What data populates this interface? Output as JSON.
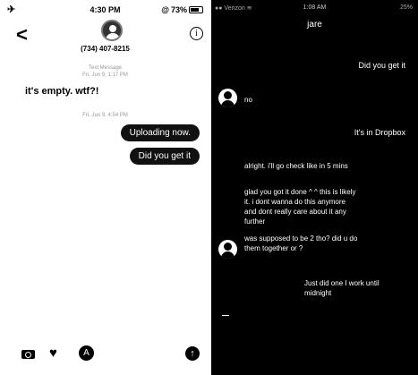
{
  "left_status": {
    "time": "4:30 PM",
    "battery": "73%"
  },
  "left_header": {
    "back_icon": "chevron-left-icon",
    "contact": "(734) 407-8215",
    "info_icon": "info-icon"
  },
  "left_meta1": [
    "Text Message",
    "Fri, Jun 9, 1:17 PM"
  ],
  "left_msg_received": "it's empty. wtf?!",
  "left_meta2": "Fri, Jun 9, 4:54 PM",
  "left_msg_sent": [
    "Uploading now.",
    "Did you get it"
  ],
  "left_bottom_icons": [
    "camera-icon",
    "heart-icon",
    "app-store-icon",
    "send-arrow-icon"
  ],
  "right_status": {
    "carrier": "Verizon",
    "time": "1:08 AM",
    "battery": "25%"
  },
  "right_title": "jare",
  "right_messages": [
    "Did you get it",
    "no",
    "It's in Dropbox",
    "alright. i'll go check like in 5 mins",
    "glad you got it done ^ ^ this is likely it. i dont wanna do this anymore and dont really care about it any further",
    "was supposed to be 2 tho? did u do them together or ?",
    "Just did one I work until midnight"
  ]
}
